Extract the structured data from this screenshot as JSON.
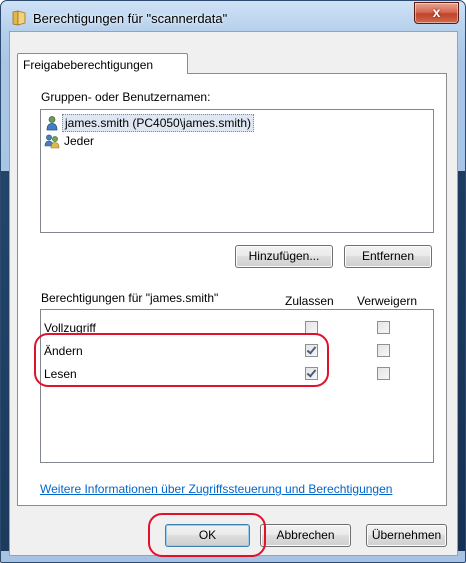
{
  "window": {
    "title": "Berechtigungen für \"scannerdata\"",
    "close_glyph": "x",
    "colors": {
      "frame": "#a9c6e6",
      "close": "#c0432a",
      "highlight": "#e2112b",
      "link": "#0066cc"
    }
  },
  "tabs": [
    {
      "label": "Freigabeberechtigungen",
      "selected": true
    }
  ],
  "groups": {
    "label": "Gruppen- oder Benutzernamen:",
    "items": [
      {
        "name": "james.smith (PC4050\\james.smith)",
        "icon": "user-icon",
        "selected": true
      },
      {
        "name": "Jeder",
        "icon": "users-group-icon",
        "selected": false
      }
    ]
  },
  "buttons": {
    "add": "Hinzufügen...",
    "remove": "Entfernen",
    "ok": "OK",
    "cancel": "Abbrechen",
    "apply": "Übernehmen"
  },
  "permissions": {
    "label": "Berechtigungen für \"james.smith\"",
    "allow_header": "Zulassen",
    "deny_header": "Verweigern",
    "rows": [
      {
        "name": "Vollzugriff",
        "allow": false,
        "deny": false
      },
      {
        "name": "Ändern",
        "allow": true,
        "deny": false
      },
      {
        "name": "Lesen",
        "allow": true,
        "deny": false
      }
    ]
  },
  "link": "Weitere Informationen über Zugriffssteuerung und Berechtigungen"
}
